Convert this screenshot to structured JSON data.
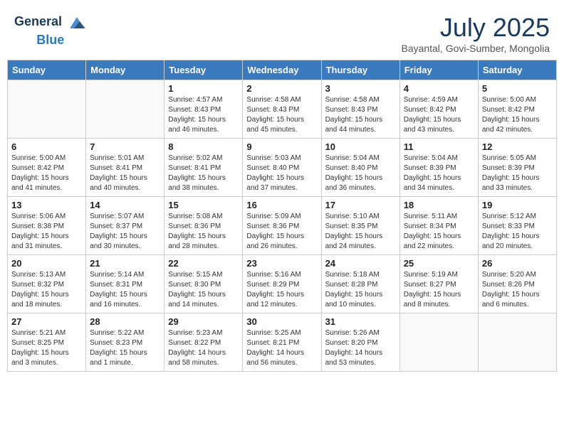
{
  "header": {
    "logo_general": "General",
    "logo_blue": "Blue",
    "month_title": "July 2025",
    "subtitle": "Bayantal, Govi-Sumber, Mongolia"
  },
  "weekdays": [
    "Sunday",
    "Monday",
    "Tuesday",
    "Wednesday",
    "Thursday",
    "Friday",
    "Saturday"
  ],
  "weeks": [
    [
      {
        "day": "",
        "info": ""
      },
      {
        "day": "",
        "info": ""
      },
      {
        "day": "1",
        "info": "Sunrise: 4:57 AM\nSunset: 8:43 PM\nDaylight: 15 hours\nand 46 minutes."
      },
      {
        "day": "2",
        "info": "Sunrise: 4:58 AM\nSunset: 8:43 PM\nDaylight: 15 hours\nand 45 minutes."
      },
      {
        "day": "3",
        "info": "Sunrise: 4:58 AM\nSunset: 8:43 PM\nDaylight: 15 hours\nand 44 minutes."
      },
      {
        "day": "4",
        "info": "Sunrise: 4:59 AM\nSunset: 8:42 PM\nDaylight: 15 hours\nand 43 minutes."
      },
      {
        "day": "5",
        "info": "Sunrise: 5:00 AM\nSunset: 8:42 PM\nDaylight: 15 hours\nand 42 minutes."
      }
    ],
    [
      {
        "day": "6",
        "info": "Sunrise: 5:00 AM\nSunset: 8:42 PM\nDaylight: 15 hours\nand 41 minutes."
      },
      {
        "day": "7",
        "info": "Sunrise: 5:01 AM\nSunset: 8:41 PM\nDaylight: 15 hours\nand 40 minutes."
      },
      {
        "day": "8",
        "info": "Sunrise: 5:02 AM\nSunset: 8:41 PM\nDaylight: 15 hours\nand 38 minutes."
      },
      {
        "day": "9",
        "info": "Sunrise: 5:03 AM\nSunset: 8:40 PM\nDaylight: 15 hours\nand 37 minutes."
      },
      {
        "day": "10",
        "info": "Sunrise: 5:04 AM\nSunset: 8:40 PM\nDaylight: 15 hours\nand 36 minutes."
      },
      {
        "day": "11",
        "info": "Sunrise: 5:04 AM\nSunset: 8:39 PM\nDaylight: 15 hours\nand 34 minutes."
      },
      {
        "day": "12",
        "info": "Sunrise: 5:05 AM\nSunset: 8:39 PM\nDaylight: 15 hours\nand 33 minutes."
      }
    ],
    [
      {
        "day": "13",
        "info": "Sunrise: 5:06 AM\nSunset: 8:38 PM\nDaylight: 15 hours\nand 31 minutes."
      },
      {
        "day": "14",
        "info": "Sunrise: 5:07 AM\nSunset: 8:37 PM\nDaylight: 15 hours\nand 30 minutes."
      },
      {
        "day": "15",
        "info": "Sunrise: 5:08 AM\nSunset: 8:36 PM\nDaylight: 15 hours\nand 28 minutes."
      },
      {
        "day": "16",
        "info": "Sunrise: 5:09 AM\nSunset: 8:36 PM\nDaylight: 15 hours\nand 26 minutes."
      },
      {
        "day": "17",
        "info": "Sunrise: 5:10 AM\nSunset: 8:35 PM\nDaylight: 15 hours\nand 24 minutes."
      },
      {
        "day": "18",
        "info": "Sunrise: 5:11 AM\nSunset: 8:34 PM\nDaylight: 15 hours\nand 22 minutes."
      },
      {
        "day": "19",
        "info": "Sunrise: 5:12 AM\nSunset: 8:33 PM\nDaylight: 15 hours\nand 20 minutes."
      }
    ],
    [
      {
        "day": "20",
        "info": "Sunrise: 5:13 AM\nSunset: 8:32 PM\nDaylight: 15 hours\nand 18 minutes."
      },
      {
        "day": "21",
        "info": "Sunrise: 5:14 AM\nSunset: 8:31 PM\nDaylight: 15 hours\nand 16 minutes."
      },
      {
        "day": "22",
        "info": "Sunrise: 5:15 AM\nSunset: 8:30 PM\nDaylight: 15 hours\nand 14 minutes."
      },
      {
        "day": "23",
        "info": "Sunrise: 5:16 AM\nSunset: 8:29 PM\nDaylight: 15 hours\nand 12 minutes."
      },
      {
        "day": "24",
        "info": "Sunrise: 5:18 AM\nSunset: 8:28 PM\nDaylight: 15 hours\nand 10 minutes."
      },
      {
        "day": "25",
        "info": "Sunrise: 5:19 AM\nSunset: 8:27 PM\nDaylight: 15 hours\nand 8 minutes."
      },
      {
        "day": "26",
        "info": "Sunrise: 5:20 AM\nSunset: 8:26 PM\nDaylight: 15 hours\nand 6 minutes."
      }
    ],
    [
      {
        "day": "27",
        "info": "Sunrise: 5:21 AM\nSunset: 8:25 PM\nDaylight: 15 hours\nand 3 minutes."
      },
      {
        "day": "28",
        "info": "Sunrise: 5:22 AM\nSunset: 8:23 PM\nDaylight: 15 hours\nand 1 minute."
      },
      {
        "day": "29",
        "info": "Sunrise: 5:23 AM\nSunset: 8:22 PM\nDaylight: 14 hours\nand 58 minutes."
      },
      {
        "day": "30",
        "info": "Sunrise: 5:25 AM\nSunset: 8:21 PM\nDaylight: 14 hours\nand 56 minutes."
      },
      {
        "day": "31",
        "info": "Sunrise: 5:26 AM\nSunset: 8:20 PM\nDaylight: 14 hours\nand 53 minutes."
      },
      {
        "day": "",
        "info": ""
      },
      {
        "day": "",
        "info": ""
      }
    ]
  ]
}
